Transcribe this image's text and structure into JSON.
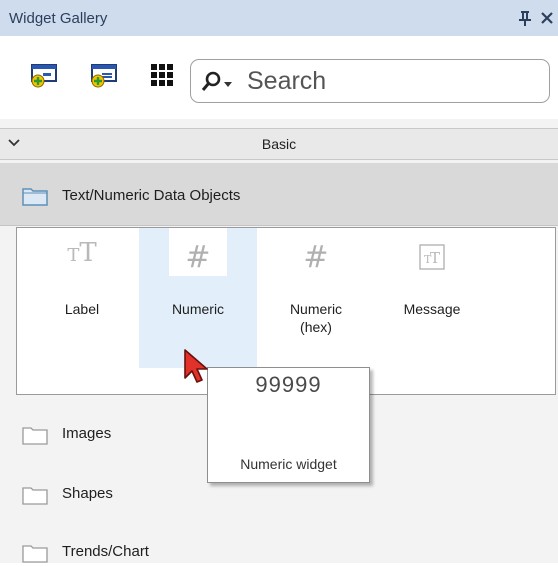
{
  "window": {
    "title": "Widget Gallery"
  },
  "toolbar": {
    "search_placeholder": "Search",
    "icons": [
      "add-widget-icon",
      "add-screen-icon",
      "grid-view-icon"
    ]
  },
  "section": {
    "name": "Basic"
  },
  "categories": [
    {
      "name": "Text/Numeric Data Objects",
      "expanded": true
    },
    {
      "name": "Images"
    },
    {
      "name": "Shapes"
    },
    {
      "name": "Trends/Chart"
    }
  ],
  "widgets": [
    {
      "glyph": "TT",
      "label": "Label"
    },
    {
      "glyph": "#",
      "label": "Numeric",
      "hovered": true
    },
    {
      "glyph": "#",
      "label": "Numeric\n(hex)"
    },
    {
      "glyph": "TT",
      "label": "Message"
    }
  ],
  "tooltip": {
    "preview": "99999",
    "description": "Numeric widget"
  },
  "colors": {
    "title_bg": "#cfdcee",
    "hover_bg": "#e2effa",
    "category_bg": "#d9d9d9",
    "cursor": "#e0312b"
  }
}
